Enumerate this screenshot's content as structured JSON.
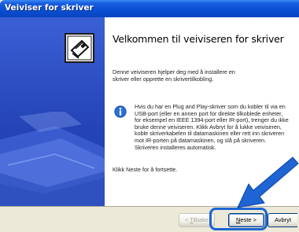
{
  "window": {
    "title": "Veiviser for skriver"
  },
  "content": {
    "heading": "Velkommen til veiviseren for skriver",
    "intro": "Denne veiviseren hjelper deg med å installere en skriver eller opprette en skrivertilkobling.",
    "info": "Hvis du har en Plug and Play-skriver som du kobler til via en USB-port (eller en annen port for direkte tilkoblede enheter, for eksempel en IEEE 1394-port eller IR-port), trenger du ikke bruke denne veiviseren. Klikk Avbryt for å lukke veiviseren, koble skriverkabelen til datamaskinen eller rett inn skriveren mot IR-porten på datamaskinen, og slå på skriveren. Skriveren installeres automatisk.",
    "next_hint": "Klikk Neste for å fortsette."
  },
  "buttons": {
    "back_lt": "< ",
    "back_key": "T",
    "back_rest": "ilbake",
    "next_key": "N",
    "next_rest": "este >",
    "cancel": "Avbryt"
  },
  "icons": {
    "wizard": "printer-wizard-icon",
    "info": "info-icon",
    "arrow": "pointer-arrow"
  },
  "colors": {
    "title_bar": "#0a4fd4",
    "left_panel": "#2545b8",
    "highlight": "#1e64d2"
  }
}
